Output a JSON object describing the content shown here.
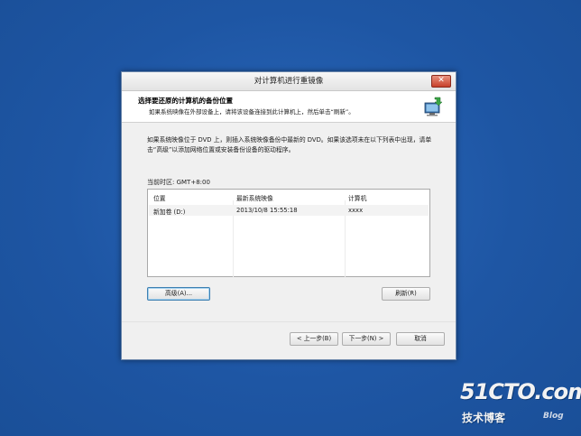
{
  "dialog": {
    "title": "对计算机进行重镜像",
    "close_glyph": "✕",
    "header": {
      "title": "选择要还原的计算机的备份位置",
      "subtitle": "如果系统映像在外部设备上，请将该设备连接到此计算机上，然后单击“刷新”。",
      "icon": "computer-restore-icon"
    },
    "body_text": "如果系统映像位于 DVD 上，则插入系统映像备份中最新的 DVD。如果该选项未在以下列表中出现，请单击“高级”以添加网络位置或安装备份设备的驱动程序。",
    "timezone_label": "当前时区: GMT+8:00",
    "table": {
      "columns": [
        "位置",
        "最新系统映像",
        "计算机"
      ],
      "rows": [
        [
          "新加卷 (D:)",
          "2013/10/8 15:55:18",
          "xxxx"
        ]
      ]
    },
    "buttons": {
      "advanced": "高级(A)...",
      "refresh": "刷新(R)",
      "back": "< 上一步(B)",
      "next": "下一步(N) >",
      "cancel": "取消"
    }
  },
  "watermark": {
    "main": "51CTO.com",
    "sub": "技术博客",
    "blog": "Blog"
  },
  "colors": {
    "desktop": "#1f59a8",
    "dialog_bg": "#f0f0f0",
    "close_red": "#c7402a"
  }
}
